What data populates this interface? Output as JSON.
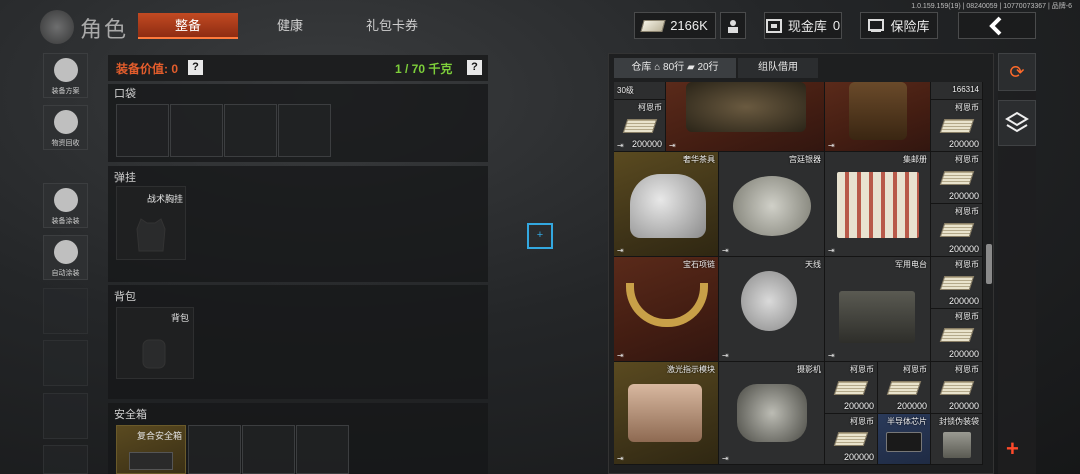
{
  "header": {
    "title": "角色",
    "tabs": [
      {
        "label": "整备",
        "active": true
      },
      {
        "label": "健康",
        "active": false
      },
      {
        "label": "礼包卡券",
        "active": false
      }
    ],
    "version": "1.0.159.159(19) | 08240059 | 10770073367 | 品牌-6",
    "cash": "2166K",
    "cash_vault_label": "现金库",
    "cash_vault_count": "0",
    "safe_box_label": "保险库",
    "back_icon": "chevron-left-icon"
  },
  "sidebar": {
    "items": [
      {
        "label": "装备方案",
        "icon": "loadout-icon"
      },
      {
        "label": "物资回收",
        "icon": "recycle-icon"
      },
      {
        "label": "装备涂装",
        "icon": "helmet-paint-icon"
      },
      {
        "label": "自动涂装",
        "icon": "auto-paint-icon"
      }
    ]
  },
  "equipment": {
    "value_label": "装备价值: 0",
    "weight": "1 / 70 千克",
    "help": "?",
    "pocket_title": "口袋",
    "rig_title": "弹挂",
    "rig_slot_label": "战术胸挂",
    "backpack_title": "背包",
    "backpack_slot_label": "背包",
    "safe_title": "安全箱",
    "safe_slot_label": "复合安全箱"
  },
  "warehouse": {
    "tabs": {
      "storage": "仓库",
      "rows_home": "80行",
      "rows_extra": "20行",
      "team_loan": "组队借用"
    },
    "level_text": "30级",
    "top_right_value": "166314",
    "currency_name": "柯恩币",
    "currency_amount": "200000",
    "items": {
      "tea_set": "奢华茶具",
      "silver_plate": "宫廷银器",
      "stamp_album": "集邮册",
      "gem_necklace": "宝石项链",
      "antenna": "天线",
      "military_radio": "军用电台",
      "laser_module": "激光指示模块",
      "camera": "摄影机",
      "semiconductor_chip": "半导体芯片",
      "sealed_box": "封锁伪装袋"
    }
  },
  "colors": {
    "accent": "#e35d2c",
    "weight_green": "#7dcf3a",
    "crosshair_blue": "#33a8e0",
    "add_red": "#ff4a2a"
  }
}
